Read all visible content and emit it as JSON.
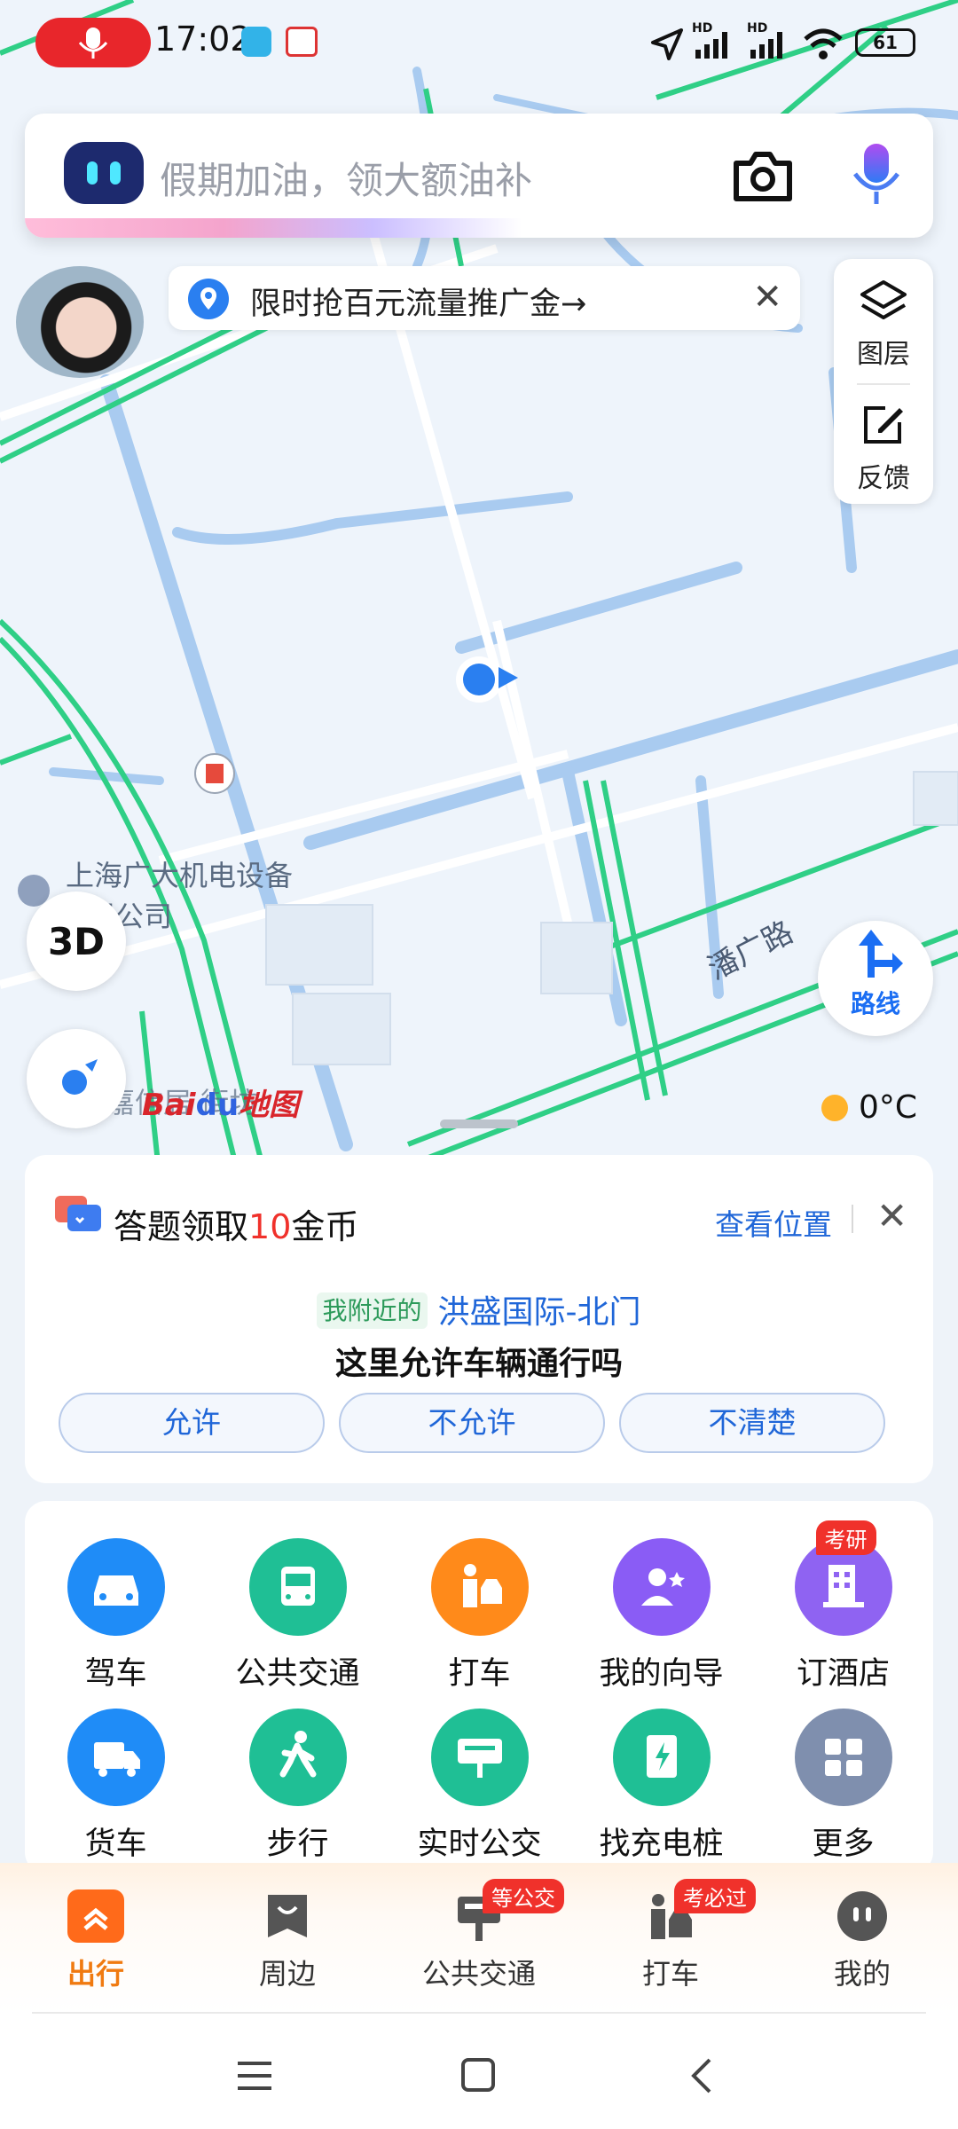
{
  "status_bar": {
    "time": "17:02",
    "network_1": "HD",
    "network_2": "HD",
    "battery": "61"
  },
  "search": {
    "placeholder": "假期加油，领大额油补"
  },
  "promo": {
    "text": "限时抢百元流量推广金→"
  },
  "map_tools": {
    "layers_label": "图层",
    "feedback_label": "反馈",
    "btn_3d": "3D",
    "route_label": "路线",
    "weather": "0°C",
    "logo": "Bai地图"
  },
  "map_labels": {
    "company_line1": "上海广大机电设备",
    "company_line2": "限公司",
    "road": "潘广路",
    "street": "嘉信居 街坊"
  },
  "question_card": {
    "title_prefix": "答题领取",
    "title_number": "10",
    "title_suffix": "金币",
    "view_position": "查看位置",
    "near_tag": "我附近的",
    "place": "洪盛国际-北门",
    "question": "这里允许车辆通行吗",
    "options": [
      "允许",
      "不允许",
      "不清楚"
    ]
  },
  "services": [
    {
      "label": "驾车",
      "icon": "car-icon",
      "color": "#1f8cf7"
    },
    {
      "label": "公共交通",
      "icon": "bus-icon",
      "color": "#1fbf95"
    },
    {
      "label": "打车",
      "icon": "taxi-icon",
      "color": "#ff8a1a"
    },
    {
      "label": "我的向导",
      "icon": "guide-icon",
      "color": "#8a5cf5"
    },
    {
      "label": "订酒店",
      "icon": "hotel-icon",
      "color": "#8f63f2",
      "badge": "考研"
    },
    {
      "label": "货车",
      "icon": "truck-icon",
      "color": "#1f8cf7"
    },
    {
      "label": "步行",
      "icon": "walk-icon",
      "color": "#1fbf95"
    },
    {
      "label": "实时公交",
      "icon": "realtime-bus-icon",
      "color": "#1fbf95"
    },
    {
      "label": "找充电桩",
      "icon": "charger-icon",
      "color": "#1fbf95"
    },
    {
      "label": "更多",
      "icon": "more-grid-icon",
      "color": "#7f8fae"
    }
  ],
  "bottom_nav": [
    {
      "label": "出行",
      "icon": "travel-icon",
      "active": true
    },
    {
      "label": "周边",
      "icon": "nearby-icon"
    },
    {
      "label": "公共交通",
      "icon": "transit-icon",
      "badge": "等公交"
    },
    {
      "label": "打车",
      "icon": "taxi-nav-icon",
      "badge": "考必过"
    },
    {
      "label": "我的",
      "icon": "profile-icon"
    }
  ],
  "colors": {
    "accent_blue": "#1f66d8",
    "active_orange": "#f07a10",
    "badge_red": "#f0312b",
    "map_road_green": "#2fcf86",
    "map_water": "#a9cbf0"
  }
}
